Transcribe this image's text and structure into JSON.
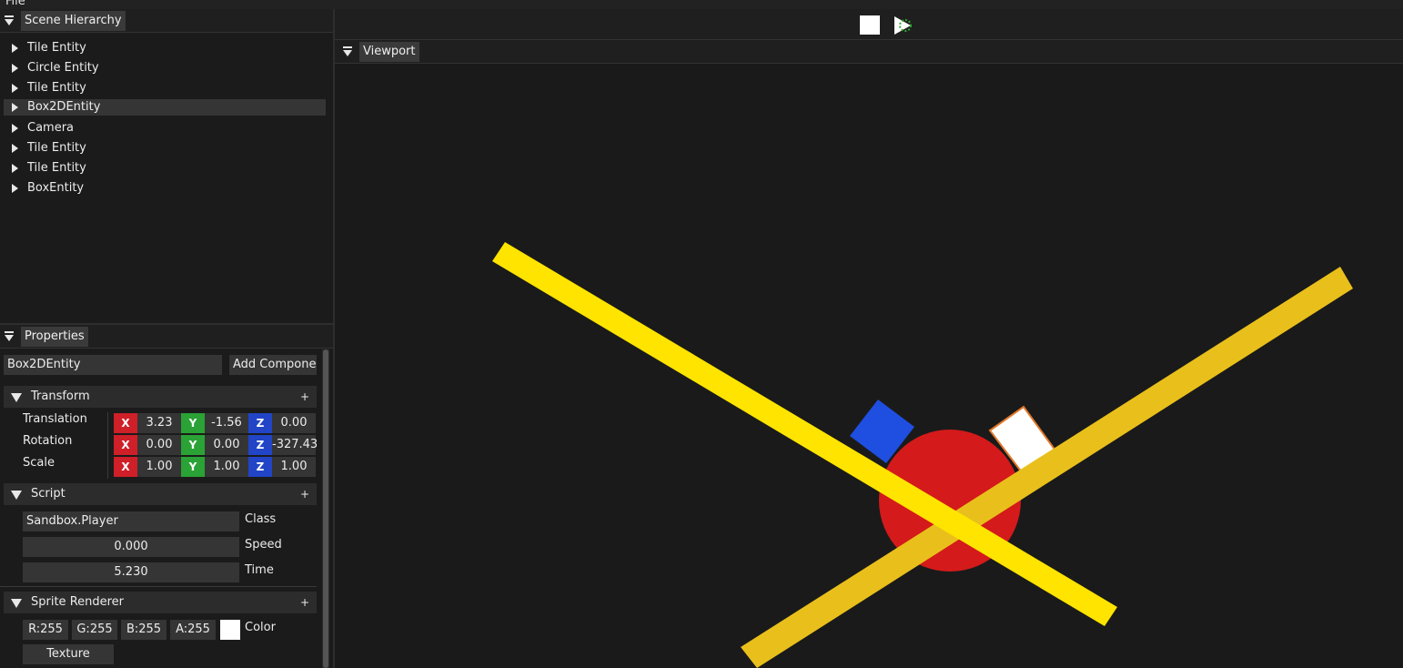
{
  "menu": {
    "file_label": "File"
  },
  "hierarchy": {
    "tab_label": "Scene Hierarchy",
    "items": [
      {
        "label": "Tile Entity"
      },
      {
        "label": "Circle Entity"
      },
      {
        "label": "Tile Entity"
      },
      {
        "label": "Box2DEntity",
        "selected": true
      },
      {
        "label": "Camera"
      },
      {
        "label": "Tile Entity"
      },
      {
        "label": "Tile Entity"
      },
      {
        "label": "BoxEntity"
      }
    ]
  },
  "properties": {
    "tab_label": "Properties",
    "entity_name": "Box2DEntity",
    "add_component_label": "Add Componen",
    "transform": {
      "title": "Transform",
      "plus": "+",
      "axis_labels": {
        "x": "X",
        "y": "Y",
        "z": "Z"
      },
      "translation": {
        "label": "Translation",
        "x": "3.23",
        "y": "-1.56",
        "z": "0.00"
      },
      "rotation": {
        "label": "Rotation",
        "x": "0.00",
        "y": "0.00",
        "z": "-327.43"
      },
      "scale": {
        "label": "Scale",
        "x": "1.00",
        "y": "1.00",
        "z": "1.00"
      }
    },
    "script": {
      "title": "Script",
      "plus": "+",
      "class_value": "Sandbox.Player",
      "class_label": "Class",
      "speed_value": "0.000",
      "speed_label": "Speed",
      "time_value": "5.230",
      "time_label": "Time"
    },
    "sprite_renderer": {
      "title": "Sprite Renderer",
      "plus": "+",
      "r": "R:255",
      "g": "G:255",
      "b": "B:255",
      "a": "A:255",
      "swatch_color": "#ffffff",
      "color_label": "Color",
      "texture_label": "Texture"
    }
  },
  "toolbar": {
    "stop_icon": "stop-icon",
    "play_icon": "play-icon"
  },
  "viewport": {
    "tab_label": "Viewport",
    "colors": {
      "yellow_bar": "#ffe400",
      "gold_bar": "#e9c01b",
      "circle": "#d41a1a",
      "blue_box": "#1f4fe0",
      "white_box": "#ffffff",
      "white_box_outline": "#e0782a"
    }
  }
}
